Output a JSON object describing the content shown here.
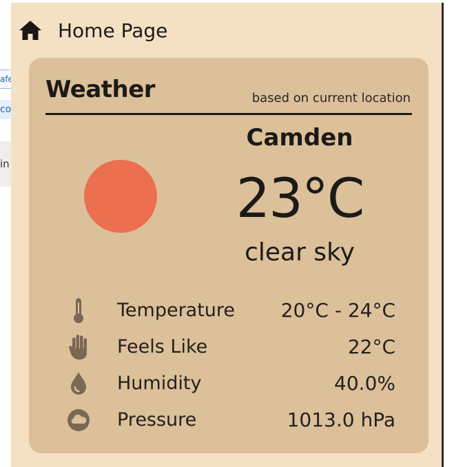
{
  "background": {
    "fragments": [
      "afe",
      "co",
      "in"
    ]
  },
  "header": {
    "title": "Home Page",
    "icon": "home-icon"
  },
  "weather": {
    "title": "Weather",
    "subtitle": "based on current location",
    "city": "Camden",
    "temperature": "23°C",
    "description": "clear sky",
    "condition_icon": "sun-icon",
    "colors": {
      "panel": "#f4e0c3",
      "card": "#dcc09a",
      "sun": "#ec6f4f",
      "icon": "#7a6855"
    },
    "details": [
      {
        "icon": "thermometer-icon",
        "label": "Temperature",
        "value": "20°C - 24°C"
      },
      {
        "icon": "hand-icon",
        "label": "Feels Like",
        "value": "22°C"
      },
      {
        "icon": "droplet-icon",
        "label": "Humidity",
        "value": "40.0%"
      },
      {
        "icon": "cloud-icon",
        "label": "Pressure",
        "value": "1013.0 hPa"
      }
    ]
  }
}
